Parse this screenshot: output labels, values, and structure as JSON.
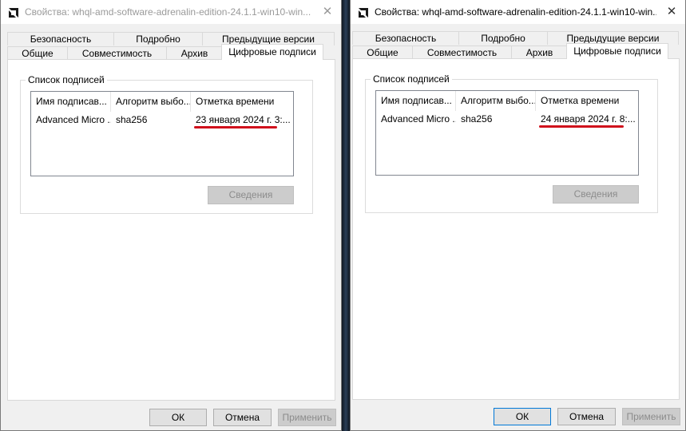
{
  "windows": [
    {
      "title": "Свойства: whql-amd-software-adrenalin-edition-24.1.1-win10-win...",
      "close_glyph": "✕",
      "tabs_top": [
        "Безопасность",
        "Подробно",
        "Предыдущие версии"
      ],
      "tabs_bottom": [
        "Общие",
        "Совместимость",
        "Архив",
        "Цифровые подписи"
      ],
      "active_tab": "Цифровые подписи",
      "group_title": "Список подписей",
      "columns": [
        "Имя подписав...",
        "Алгоритм выбо...",
        "Отметка времени"
      ],
      "row": {
        "name": "Advanced Micro ...",
        "algorithm": "sha256",
        "timestamp": "23 января 2024 г. 3:..."
      },
      "details_label": "Сведения",
      "ok_label": "ОК",
      "cancel_label": "Отмена",
      "apply_label": "Применить"
    },
    {
      "title": "Свойства: whql-amd-software-adrenalin-edition-24.1.1-win10-win...",
      "close_glyph": "✕",
      "tabs_top": [
        "Безопасность",
        "Подробно",
        "Предыдущие версии"
      ],
      "tabs_bottom": [
        "Общие",
        "Совместимость",
        "Архив",
        "Цифровые подписи"
      ],
      "active_tab": "Цифровые подписи",
      "group_title": "Список подписей",
      "columns": [
        "Имя подписав...",
        "Алгоритм выбо...",
        "Отметка времени"
      ],
      "row": {
        "name": "Advanced Micro ...",
        "algorithm": "sha256",
        "timestamp": "24 января 2024 г. 8:..."
      },
      "details_label": "Сведения",
      "ok_label": "ОК",
      "cancel_label": "Отмена",
      "apply_label": "Применить"
    }
  ],
  "colors": {
    "highlight_underline": "#d0101c",
    "default_button_border": "#0078d7"
  },
  "icons": {
    "app": "amd-logo-icon",
    "close": "close-icon"
  }
}
